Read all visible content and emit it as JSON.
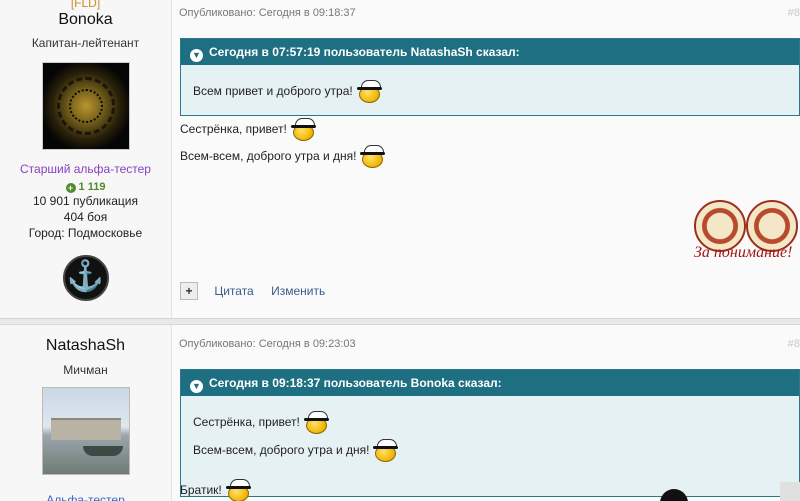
{
  "posts": [
    {
      "author": {
        "clan": "[FLD]",
        "name": "Bonoka",
        "rank": "Капитан-лейтенант",
        "group": "Старший альфа-тестер",
        "reputation": "1 119",
        "publications": "10 901 публикация",
        "battles": "404 боя",
        "city": "Город: Подмосковье",
        "badge_icon": "anchor-icon"
      },
      "published": "Опубликовано: Сегодня в 09:18:37",
      "post_number": "#8",
      "quote": {
        "header": "Сегодня в 07:57:19 пользователь NatashaSh сказал:",
        "lines": [
          "Всем привет и доброго утра!"
        ]
      },
      "lines": [
        "Сестрёнка, привет!",
        "Всем-всем, доброго утра и дня!"
      ],
      "stamp_text": "За понимание!",
      "actions": {
        "plus": "+",
        "quote": "Цитата",
        "edit": "Изменить"
      }
    },
    {
      "author": {
        "name": "NatashaSh",
        "rank": "Мичман",
        "group": "Альфа-тестер"
      },
      "published": "Опубликовано: Сегодня в 09:23:03",
      "post_number": "#8",
      "quote": {
        "header": "Сегодня в 09:18:37 пользователь Bonoka сказал:",
        "lines": [
          "Сестрёнка, привет!",
          "Всем-всем, доброго утра и дня!"
        ]
      },
      "lines": [
        "Братик!"
      ]
    }
  ],
  "colors": {
    "quote_header": "#1e6f82",
    "quote_body": "#e6f1f3",
    "clan": "#cf8a2e",
    "group_senior": "#8a3fc0",
    "group_alpha": "#3366cc",
    "reputation": "#4c8c2b",
    "link": "#3a5c8c"
  }
}
